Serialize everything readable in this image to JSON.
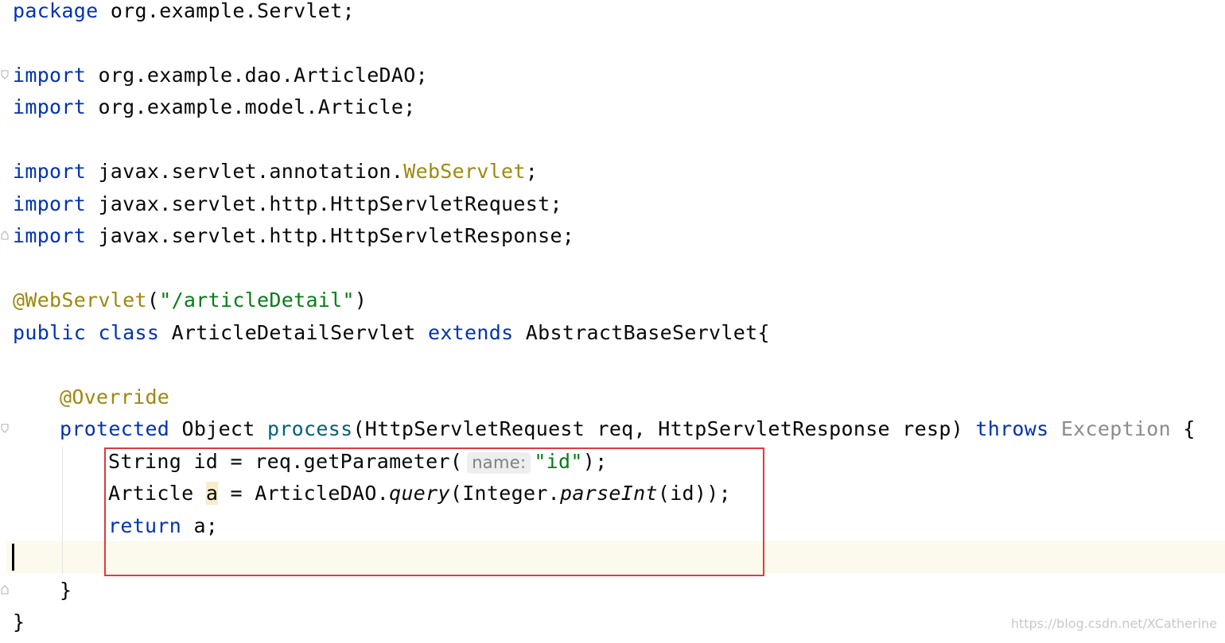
{
  "editor": {
    "lines": {
      "l1": {
        "kw": "package",
        "rest": " org.example.Servlet;"
      },
      "l3": {
        "kw": "import",
        "rest": " org.example.dao.ArticleDAO;"
      },
      "l4": {
        "kw": "import",
        "rest": " org.example.model.Article;"
      },
      "l6": {
        "kw": "import",
        "rest": " javax.servlet.annotation.",
        "ann": "WebServlet",
        "end": ";"
      },
      "l7": {
        "kw": "import",
        "rest": " javax.servlet.http.HttpServletRequest;"
      },
      "l8": {
        "kw": "import",
        "rest": " javax.servlet.http.HttpServletResponse;"
      },
      "l10": {
        "ann": "@WebServlet",
        "open": "(",
        "str": "\"/articleDetail\"",
        "close": ")"
      },
      "l11": {
        "kw1": "public",
        "kw2": "class",
        "name": " ArticleDetailServlet ",
        "kw3": "extends",
        "rest": " AbstractBaseServlet{"
      },
      "l13": {
        "ann": "@Override"
      },
      "l14": {
        "kw": "protected",
        "type": " Object ",
        "fn": "process",
        "params": "(HttpServletRequest req, HttpServletResponse resp) ",
        "kw2": "throws",
        "exc": " Exception",
        "end": " {"
      },
      "l15": {
        "pre": "String id = req.getParameter(",
        "hint": "name:",
        "str": "\"id\"",
        "end": ");"
      },
      "l16": {
        "pre": "Article ",
        "var": "a",
        "mid": " = ArticleDAO.",
        "fn": "query",
        "mid2": "(Integer.",
        "fn2": "parseInt",
        "end": "(id));"
      },
      "l17": {
        "kw": "return",
        "rest": " a;"
      },
      "l19": {
        "text": "}"
      },
      "l20": {
        "text": "}"
      }
    }
  },
  "watermark": "https://blog.csdn.net/XCatherine",
  "colors": {
    "keyword": "#0033b3",
    "annotation": "#9e880d",
    "string": "#067d17",
    "highlight_box": "#e0393e",
    "current_line": "#fcfaed"
  }
}
